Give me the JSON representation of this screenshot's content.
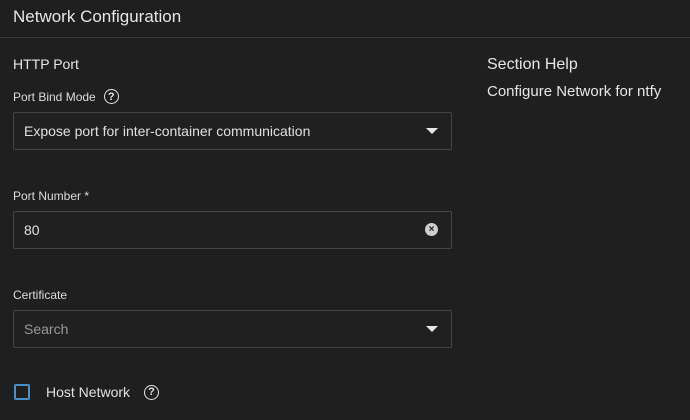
{
  "header": {
    "title": "Network Configuration"
  },
  "section": {
    "title": "HTTP Port"
  },
  "port_bind_mode": {
    "label": "Port Bind Mode",
    "value": "Expose port for inter-container communication",
    "help_icon": "question-circle-icon",
    "dropdown_icon": "chevron-down-icon"
  },
  "port_number": {
    "label": "Port Number *",
    "value": "80",
    "clear_icon": "clear-circle-icon"
  },
  "certificate": {
    "label": "Certificate",
    "placeholder": "Search",
    "dropdown_icon": "chevron-down-icon"
  },
  "host_network": {
    "label": "Host Network",
    "checked": false,
    "help_icon": "question-circle-icon"
  },
  "help_panel": {
    "title": "Section Help",
    "text": "Configure Network for ntfy"
  },
  "colors": {
    "background": "#1f1f1f",
    "border": "#454545",
    "text": "#e6e6e6",
    "checkbox_border": "#4a90c4"
  }
}
